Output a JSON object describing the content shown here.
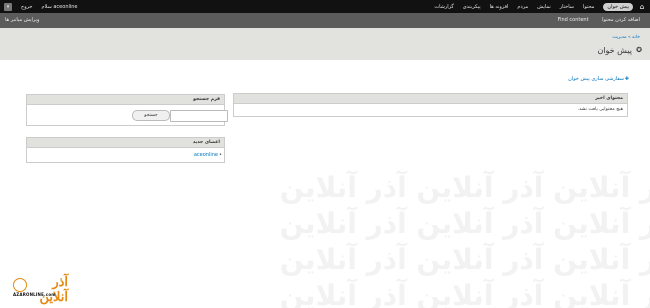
{
  "toolbar": {
    "home_icon": "home-icon",
    "items": [
      "پیش خوان",
      "محتوا",
      "ساختار",
      "نمایش",
      "مردم",
      "افزونه ها",
      "پیکربندی",
      "گزارشات"
    ],
    "account": "سلام aceonline",
    "logout": "خروج",
    "toggle_icon": "arrow-icon"
  },
  "shortcuts": {
    "items": [
      "اضافه کردن محتوا",
      "Find content"
    ],
    "edit": "ویرایش میانبر ها"
  },
  "breadcrumb": "خانه » مدیریت",
  "page_title": "پیش خوان",
  "customize": "سفارشی سازی پیش خوان",
  "recent_content": {
    "title": "محتوای اخیر",
    "empty": "هیچ محتوایی یافت نشد."
  },
  "search_form": {
    "title": "فرم جستجو",
    "button": "جستجو",
    "value": ""
  },
  "new_users": {
    "title": "اعضای جدید",
    "user": "aceonline"
  },
  "watermark_text": "آذر آنلاین آذر آنلاین آذر آنلاین",
  "logo": {
    "main": "آذر آنلاین",
    "sub": "AZARONLINE.com"
  },
  "colors": {
    "toolbar_bg": "#111111",
    "shortcut_bg": "#5b5b5b",
    "header_bg": "#e2e2df",
    "link": "#0074bd",
    "logo": "#e48a12"
  }
}
